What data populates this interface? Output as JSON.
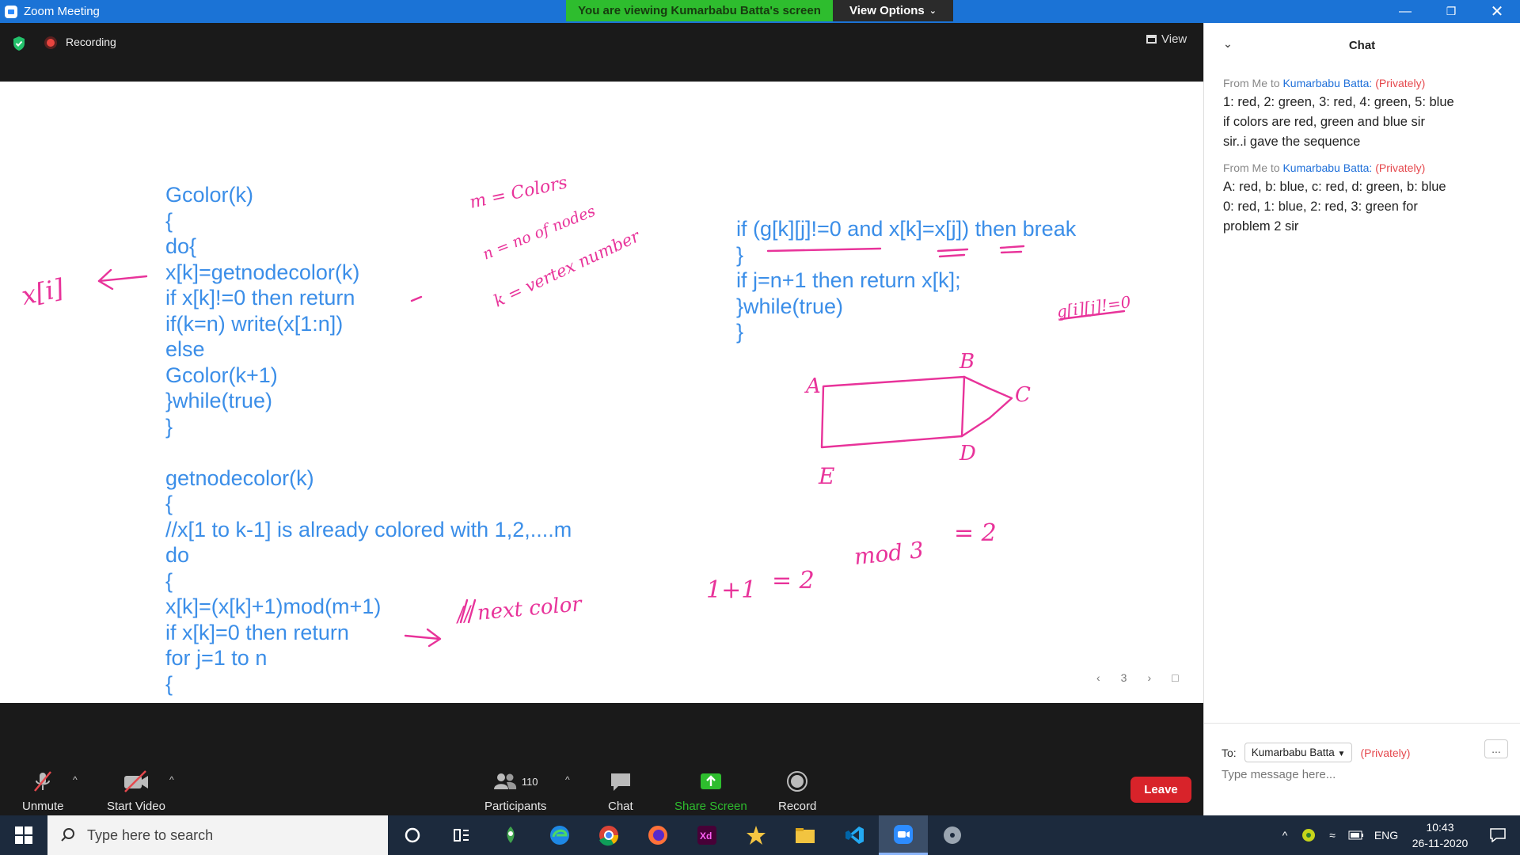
{
  "window": {
    "title": "Zoom Meeting",
    "viewing_banner": "You are viewing Kumarbabu Batta's screen",
    "view_options": "View Options"
  },
  "meeting": {
    "recording_label": "Recording",
    "view_label": "View"
  },
  "shared_screen": {
    "code_left": [
      "Gcolor(k)",
      "{",
      "do{",
      "x[k]=getnodecolor(k)",
      "if x[k]!=0 then return",
      "if(k=n) write(x[1:n])",
      "else",
      "Gcolor(k+1)",
      "}while(true)",
      "}",
      "",
      "getnodecolor(k)",
      "{",
      "//x[1 to k-1] is already colored with 1,2,....m",
      "do",
      "{",
      "x[k]=(x[k]+1)mod(m+1)",
      "if x[k]=0 then return",
      "for j=1 to n",
      "{"
    ],
    "code_right": [
      "if (g[k][j]!=0 and x[k]=x[j]) then break",
      "}",
      "if j=n+1 then return x[k];",
      "}while(true)",
      "}"
    ],
    "annotations": {
      "m_colors": "m = Colors",
      "n_nodes": "n = no of nodes",
      "k_vertex": "k = vertex number",
      "x_i": "x[i]",
      "next_color": "// next color",
      "g_ij": "g[i][j]!=0",
      "calc_1": "1+1",
      "calc_2": "= 2",
      "calc_3": "mod 3",
      "calc_4": "= 2",
      "graph_A": "A",
      "graph_B": "B",
      "graph_C": "C",
      "graph_D": "D",
      "graph_E": "E"
    },
    "page": "3"
  },
  "toolbar": {
    "unmute": "Unmute",
    "start_video": "Start Video",
    "participants": "Participants",
    "participants_count": "110",
    "chat": "Chat",
    "share_screen": "Share Screen",
    "record": "Record",
    "leave": "Leave"
  },
  "chat": {
    "title": "Chat",
    "messages": [
      {
        "from": "From Me to",
        "to": "Kumarbabu Batta:",
        "privacy": "(Privately)",
        "lines": [
          "1: red, 2: green, 3: red, 4: green, 5: blue",
          "if colors are red, green and blue sir",
          "sir..i gave the sequence"
        ]
      },
      {
        "from": "From Me to",
        "to": "Kumarbabu Batta:",
        "privacy": "(Privately)",
        "lines": [
          "A: red, b: blue, c: red, d: green, b: blue",
          "0: red, 1: blue, 2: red, 3: green for",
          "problem 2 sir"
        ]
      }
    ],
    "to_label": "To:",
    "recipient": "Kumarbabu Batta",
    "privacy": "(Privately)",
    "input_placeholder": "Type message here...",
    "more": "..."
  },
  "taskbar": {
    "search_placeholder": "Type here to search",
    "language": "ENG",
    "time": "10:43",
    "date": "26-11-2020"
  },
  "colors": {
    "zoom_blue": "#1b73d6",
    "banner_green": "#2ebd2e",
    "code_blue": "#3b8ee8",
    "ink_pink": "#e8339a",
    "leave_red": "#d8232a"
  }
}
